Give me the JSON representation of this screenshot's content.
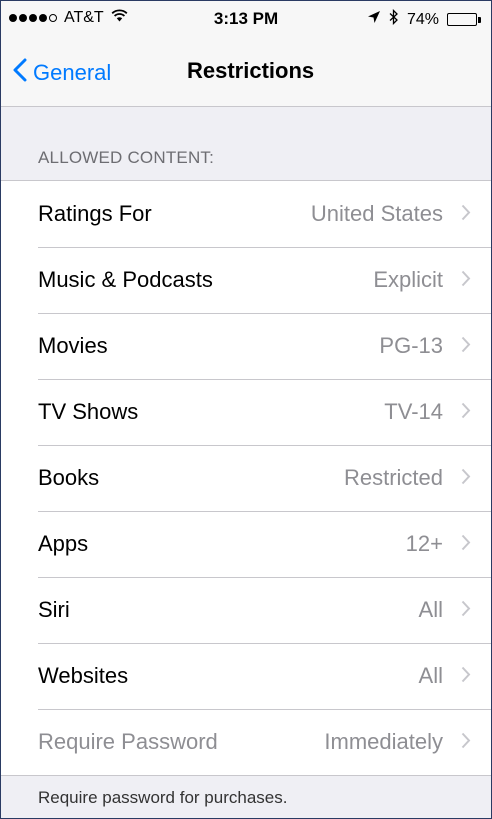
{
  "status_bar": {
    "carrier": "AT&T",
    "time": "3:13 PM",
    "battery_text": "74%",
    "battery_level": 0.74
  },
  "nav": {
    "back_label": "General",
    "title": "Restrictions"
  },
  "section": {
    "header": "ALLOWED CONTENT:"
  },
  "rows": [
    {
      "label": "Ratings For",
      "value": "United States"
    },
    {
      "label": "Music & Podcasts",
      "value": "Explicit"
    },
    {
      "label": "Movies",
      "value": "PG-13"
    },
    {
      "label": "TV Shows",
      "value": "TV-14"
    },
    {
      "label": "Books",
      "value": "Restricted"
    },
    {
      "label": "Apps",
      "value": "12+"
    },
    {
      "label": "Siri",
      "value": "All"
    },
    {
      "label": "Websites",
      "value": "All"
    },
    {
      "label": "Require Password",
      "value": "Immediately"
    }
  ],
  "footer": "Require password for purchases.",
  "colors": {
    "accent": "#007aff",
    "secondary_text": "#8e8e93",
    "background": "#efeff4"
  }
}
